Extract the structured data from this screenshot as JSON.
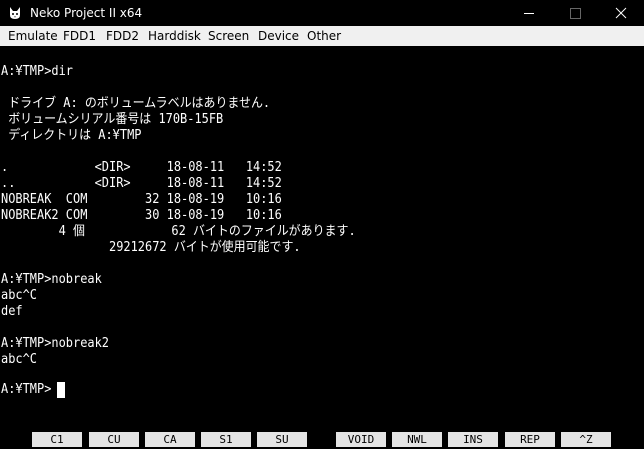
{
  "window": {
    "title": "Neko Project II x64"
  },
  "menu": [
    "Emulate",
    "FDD1",
    "FDD2",
    "Harddisk",
    "Screen",
    "Device",
    "Other"
  ],
  "terminal": {
    "lines": [
      "",
      "A:¥TMP>dir",
      "",
      " ドライブ A: のボリュームラベルはありません.",
      " ボリュームシリアル番号は 170B-15FB",
      " ディレクトリは A:¥TMP",
      "",
      ".            <DIR>     18-08-11   14:52",
      "..           <DIR>     18-08-11   14:52",
      "NOBREAK  COM        32 18-08-19   10:16",
      "NOBREAK2 COM        30 18-08-19   10:16",
      "        4 個            62 バイトのファイルがあります.",
      "               29212672 バイトが使用可能です.",
      "",
      "A:¥TMP>nobreak",
      "abc^C",
      "def",
      "",
      "A:¥TMP>nobreak2",
      "abc^C",
      "",
      "A:¥TMP>"
    ]
  },
  "function_keys": [
    "C1",
    "CU",
    "CA",
    "S1",
    "SU",
    "VOID",
    "NWL",
    "INS",
    "REP",
    "^Z"
  ]
}
